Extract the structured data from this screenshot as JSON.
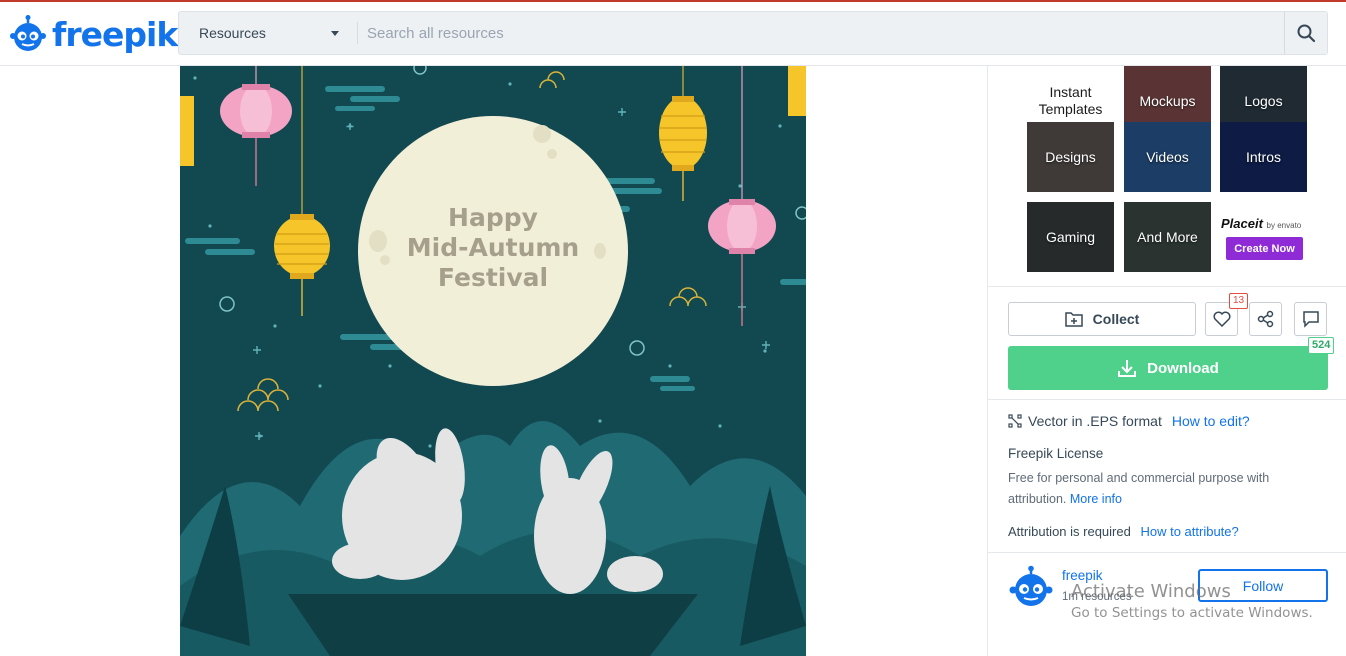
{
  "brand": {
    "name": "freepik",
    "color": "#1273eb"
  },
  "search": {
    "category": "Resources",
    "placeholder": "Search all resources"
  },
  "preview": {
    "headline_line1": "Happy",
    "headline_line2": "Mid-Autumn",
    "headline_line3": "Festival"
  },
  "promo": {
    "tiles": [
      "Instant Templates",
      "Mockups",
      "Logos",
      "Designs",
      "Videos",
      "Intros",
      "Gaming",
      "And More"
    ],
    "brand_name": "Placeit",
    "brand_by": "by envato",
    "cta": "Create Now"
  },
  "actions": {
    "collect": "Collect",
    "like_count": "13",
    "download": "Download",
    "download_count": "524"
  },
  "details": {
    "format": "Vector in .EPS format",
    "how_to_edit": "How to edit?",
    "license_title": "Freepik License",
    "license_desc": "Free for personal and commercial purpose with attribution.",
    "more_info": "More info",
    "attribution_required": "Attribution is required",
    "how_to_attribute": "How to attribute?"
  },
  "author": {
    "name": "freepik",
    "resources": "1m resources",
    "follow": "Follow"
  },
  "os_overlay": {
    "line1": "Activate Windows",
    "line2": "Go to Settings to activate Windows."
  }
}
